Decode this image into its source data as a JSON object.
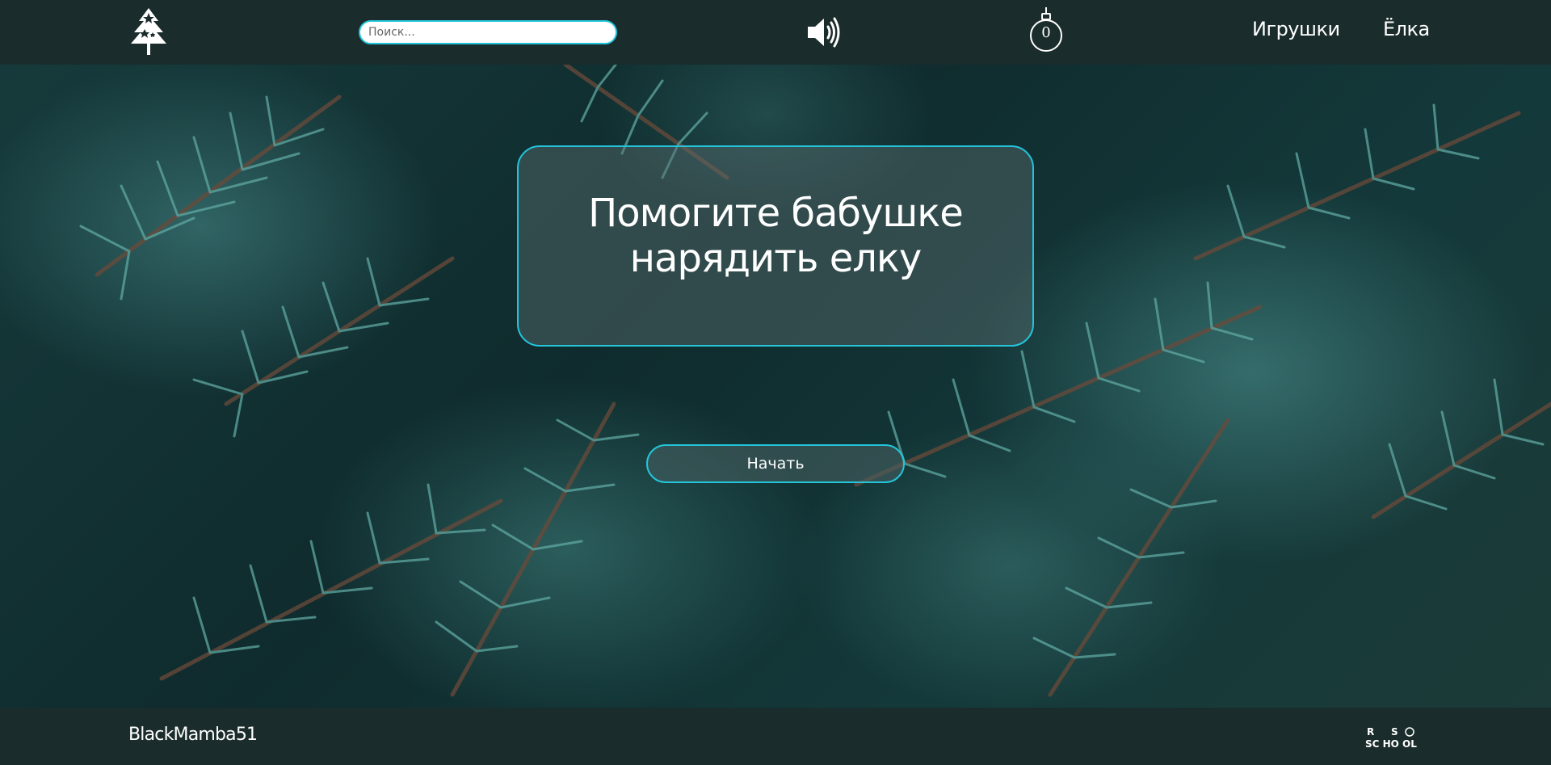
{
  "header": {
    "search": {
      "placeholder": "Поиск..."
    },
    "favorites_count": "0",
    "nav": {
      "toys_label": "Игрушки",
      "tree_label": "Ёлка"
    }
  },
  "main": {
    "title_line1": "Помогите бабушке",
    "title_line2": "нарядить елку",
    "start_label": "Начать"
  },
  "footer": {
    "author": "BlackMamba51",
    "school_logo_text": "RS SCHOOL"
  },
  "icons": {
    "logo": "tree-logo-icon",
    "sound": "speaker-icon",
    "favorites": "ornament-ball-icon",
    "school": "rs-school-logo"
  },
  "colors": {
    "header_bg": "#1a2c2b",
    "accent_border": "#24c5db",
    "text": "#ffffff"
  }
}
